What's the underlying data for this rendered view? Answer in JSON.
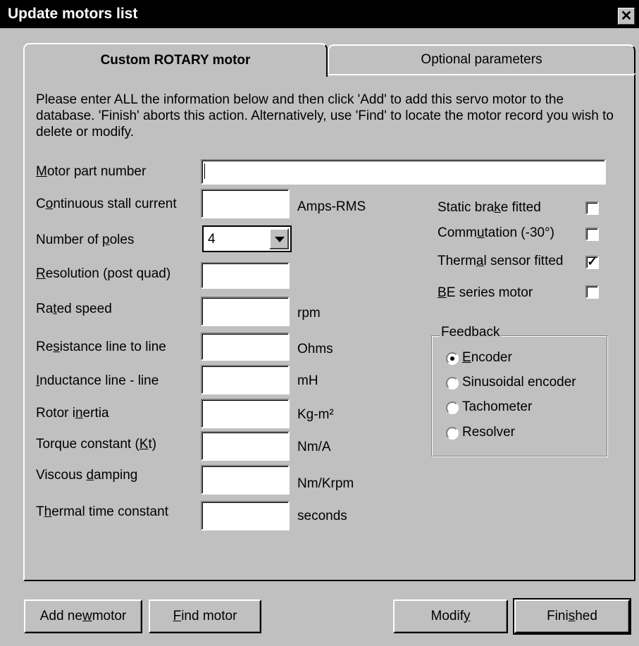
{
  "window": {
    "title": "Update motors list"
  },
  "tabs": {
    "active": "Custom ROTARY motor",
    "inactive": "Optional parameters"
  },
  "intro": "Please enter ALL the information below and then click 'Add' to add this servo motor to the database. 'Finish' aborts this action. Alternatively, use 'Find' to locate the motor record you wish to delete or modify.",
  "fields": {
    "part_number": {
      "a": "",
      "u": "M",
      "b": "otor part number",
      "value": ""
    },
    "stall_current": {
      "a": "C",
      "u": "o",
      "b": "ntinuous stall current",
      "unit": "Amps-RMS",
      "value": ""
    },
    "poles": {
      "a": "Number of ",
      "u": "p",
      "b": "oles",
      "value": "4"
    },
    "resolution": {
      "a": "",
      "u": "R",
      "b": "esolution (post quad)",
      "value": ""
    },
    "rated_speed": {
      "a": "Ra",
      "u": "t",
      "b": "ed speed",
      "unit": "rpm",
      "value": ""
    },
    "resistance": {
      "a": "Re",
      "u": "s",
      "b": "istance line to line",
      "unit": "Ohms",
      "value": ""
    },
    "inductance": {
      "a": "",
      "u": "I",
      "b": "nductance line - line",
      "unit": "mH",
      "value": ""
    },
    "inertia": {
      "a": "Rotor i",
      "u": "n",
      "b": "ertia",
      "unit": "Kg-m²",
      "value": ""
    },
    "torque": {
      "a": "Torque constant (",
      "u": "K",
      "b": "t)",
      "unit": "Nm/A",
      "value": ""
    },
    "damping": {
      "a": "Viscous ",
      "u": "d",
      "b": "amping",
      "unit": "Nm/Krpm",
      "value": ""
    },
    "thermal_time": {
      "a": "T",
      "u": "h",
      "b": "ermal time constant",
      "unit": "seconds",
      "value": ""
    }
  },
  "options": {
    "brake": {
      "a": "Static bra",
      "u": "k",
      "b": "e fitted",
      "checked": false
    },
    "commutation": {
      "a": "Comm",
      "u": "u",
      "b": "tation (-30°)",
      "checked": false
    },
    "thermal_sensor": {
      "a": "Therm",
      "u": "a",
      "b": "l sensor fitted",
      "checked": true,
      "mark": "✓"
    },
    "be_series": {
      "a": "",
      "u": "B",
      "b": "E series motor",
      "checked": false
    }
  },
  "feedback": {
    "title": "Feedback",
    "options": [
      {
        "a": "",
        "u": "E",
        "b": "ncoder",
        "selected": true
      },
      {
        "a": "Sinusoidal encoder",
        "u": "",
        "b": "",
        "selected": false
      },
      {
        "a": "Tachometer",
        "u": "",
        "b": "",
        "selected": false
      },
      {
        "a": "Resolver",
        "u": "",
        "b": "",
        "selected": false
      }
    ]
  },
  "buttons": {
    "add": {
      "a": "Add ne",
      "u": "w",
      "b": " motor"
    },
    "find": {
      "a": "",
      "u": "F",
      "b": "ind motor"
    },
    "modify": {
      "a": "Modif",
      "u": "y",
      "b": ""
    },
    "finished": {
      "a": "Fini",
      "u": "s",
      "b": "hed"
    }
  }
}
